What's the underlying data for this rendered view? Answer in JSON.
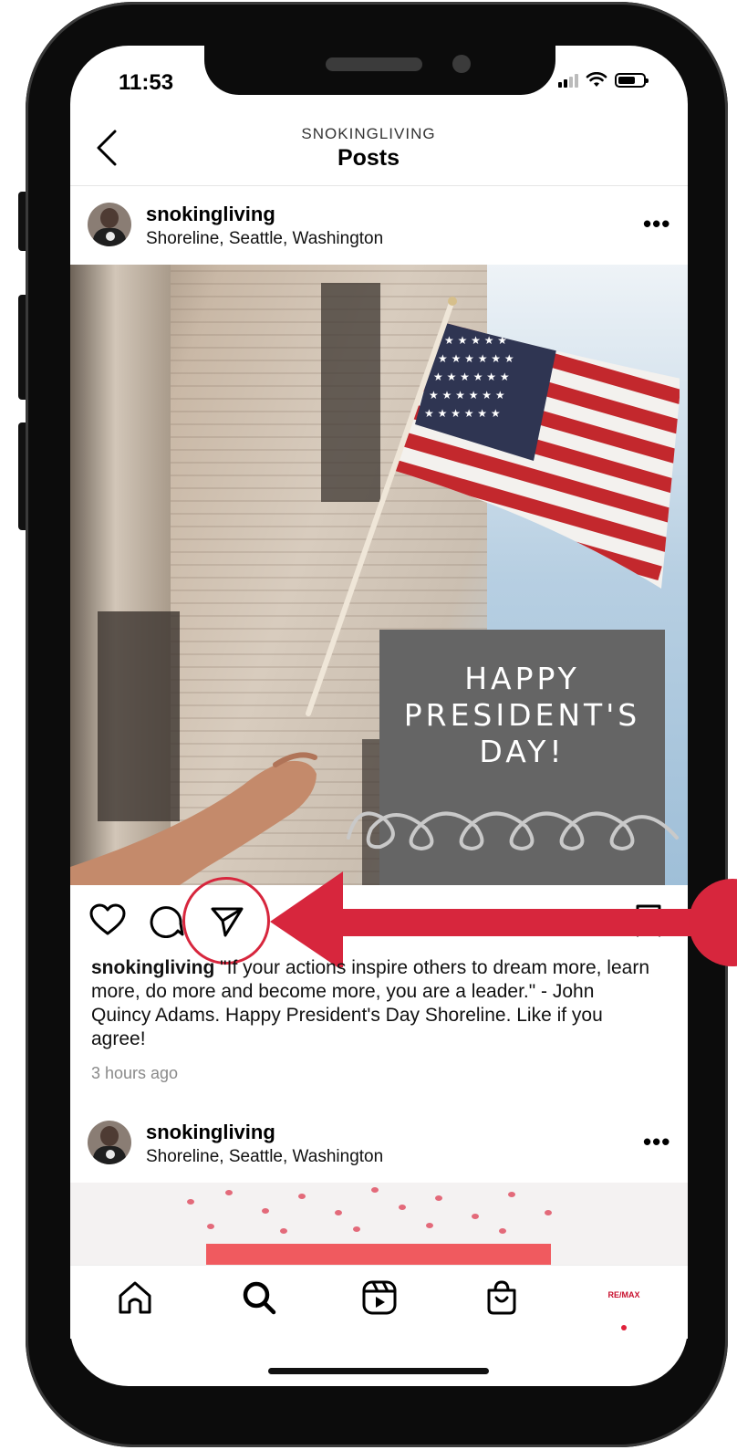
{
  "status_bar": {
    "time": "11:53"
  },
  "header": {
    "account": "SNOKINGLIVING",
    "title": "Posts"
  },
  "post": {
    "username": "snokingliving",
    "location": "Shoreline, Seattle, Washington",
    "image_text": "HAPPY\nPRESIDENT'S\nDAY!",
    "caption_user": "snokingliving",
    "caption_text": " \"If your actions inspire others to dream more, learn more, do more and become more, you are a leader.\" - John Quincy Adams. Happy President's Day Shoreline. Like if you agree!",
    "time_ago": "3 hours ago"
  },
  "post2": {
    "username": "snokingliving",
    "location": "Shoreline, Seattle, Washington"
  },
  "bottom_nav": {
    "items": [
      "home-icon",
      "search-icon",
      "reels-icon",
      "shop-icon",
      "profile-avatar"
    ],
    "profile_logo": "RE/MAX"
  },
  "colors": {
    "accent_red": "#d7263d",
    "text": "#111111",
    "greeting_box": "#656565"
  }
}
